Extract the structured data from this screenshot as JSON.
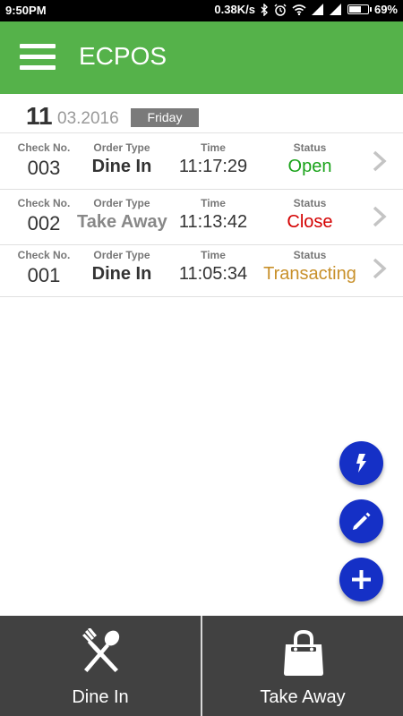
{
  "status_bar": {
    "time": "9:50PM",
    "network_speed": "0.38K/s",
    "battery_percent": "69%",
    "battery_level": 0.69,
    "icons": [
      "bluetooth-icon",
      "alarm-icon",
      "wifi-icon",
      "signal-icon",
      "signal-icon",
      "battery-icon"
    ]
  },
  "appbar": {
    "title": "ECPOS",
    "menu_icon": "hamburger-menu-icon",
    "color": "#55b24a"
  },
  "date": {
    "day": "11",
    "month_year": "03.2016",
    "weekday": "Friday"
  },
  "orders": {
    "labels": {
      "check_no": "Check No.",
      "order_type": "Order Type",
      "time": "Time",
      "status": "Status"
    },
    "rows": [
      {
        "check_no": "003",
        "order_type": "Dine In",
        "time": "11:17:29",
        "status": "Open",
        "status_color": "#1aa31a"
      },
      {
        "check_no": "002",
        "order_type": "Take Away",
        "time": "11:13:42",
        "status": "Close",
        "status_color": "#d40000"
      },
      {
        "check_no": "001",
        "order_type": "Dine In",
        "time": "11:05:34",
        "status": "Transacting",
        "status_color": "#c8902a"
      }
    ]
  },
  "fabs": [
    {
      "icon": "lightning-icon"
    },
    {
      "icon": "pencil-icon"
    },
    {
      "icon": "plus-icon"
    }
  ],
  "bottom_nav": {
    "dine_in": {
      "label": "Dine In",
      "icon": "fork-spoon-icon"
    },
    "take_away": {
      "label": "Take Away",
      "icon": "shopping-bag-icon"
    }
  },
  "colors": {
    "accent": "#55b24a",
    "fab": "#1530c6",
    "bottom_bar": "#414141"
  }
}
